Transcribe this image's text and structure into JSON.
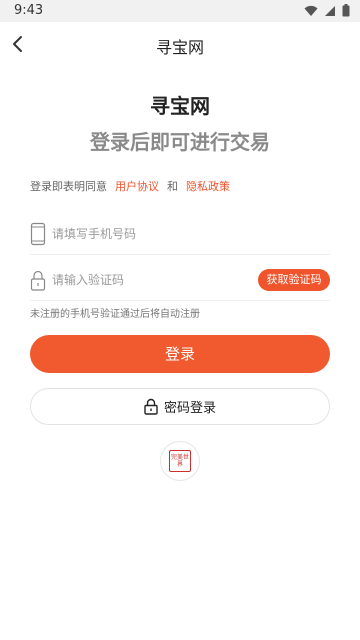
{
  "status_bar": {
    "time": "9:43"
  },
  "header": {
    "title": "寻宝网"
  },
  "brand": {
    "name": "寻宝网",
    "slogan": "登录后即可进行交易"
  },
  "agreement": {
    "prefix": "登录即表明同意",
    "user_agreement": "用户协议",
    "and": "和",
    "privacy_policy": "隐私政策"
  },
  "phone_field": {
    "placeholder": "请填写手机号码",
    "value": ""
  },
  "code_field": {
    "placeholder": "请输入验证码",
    "value": "",
    "button_label": "获取验证码"
  },
  "hint": "未注册的手机号验证通过后将自动注册",
  "login_button": "登录",
  "password_login_button": "密码登录",
  "third_party": {
    "logo_text": "完美世界",
    "icon": "perfect-world-logo"
  },
  "colors": {
    "accent": "#f15a2e",
    "link": "#f0522c",
    "status_bar_bg": "#f1f1f1"
  }
}
